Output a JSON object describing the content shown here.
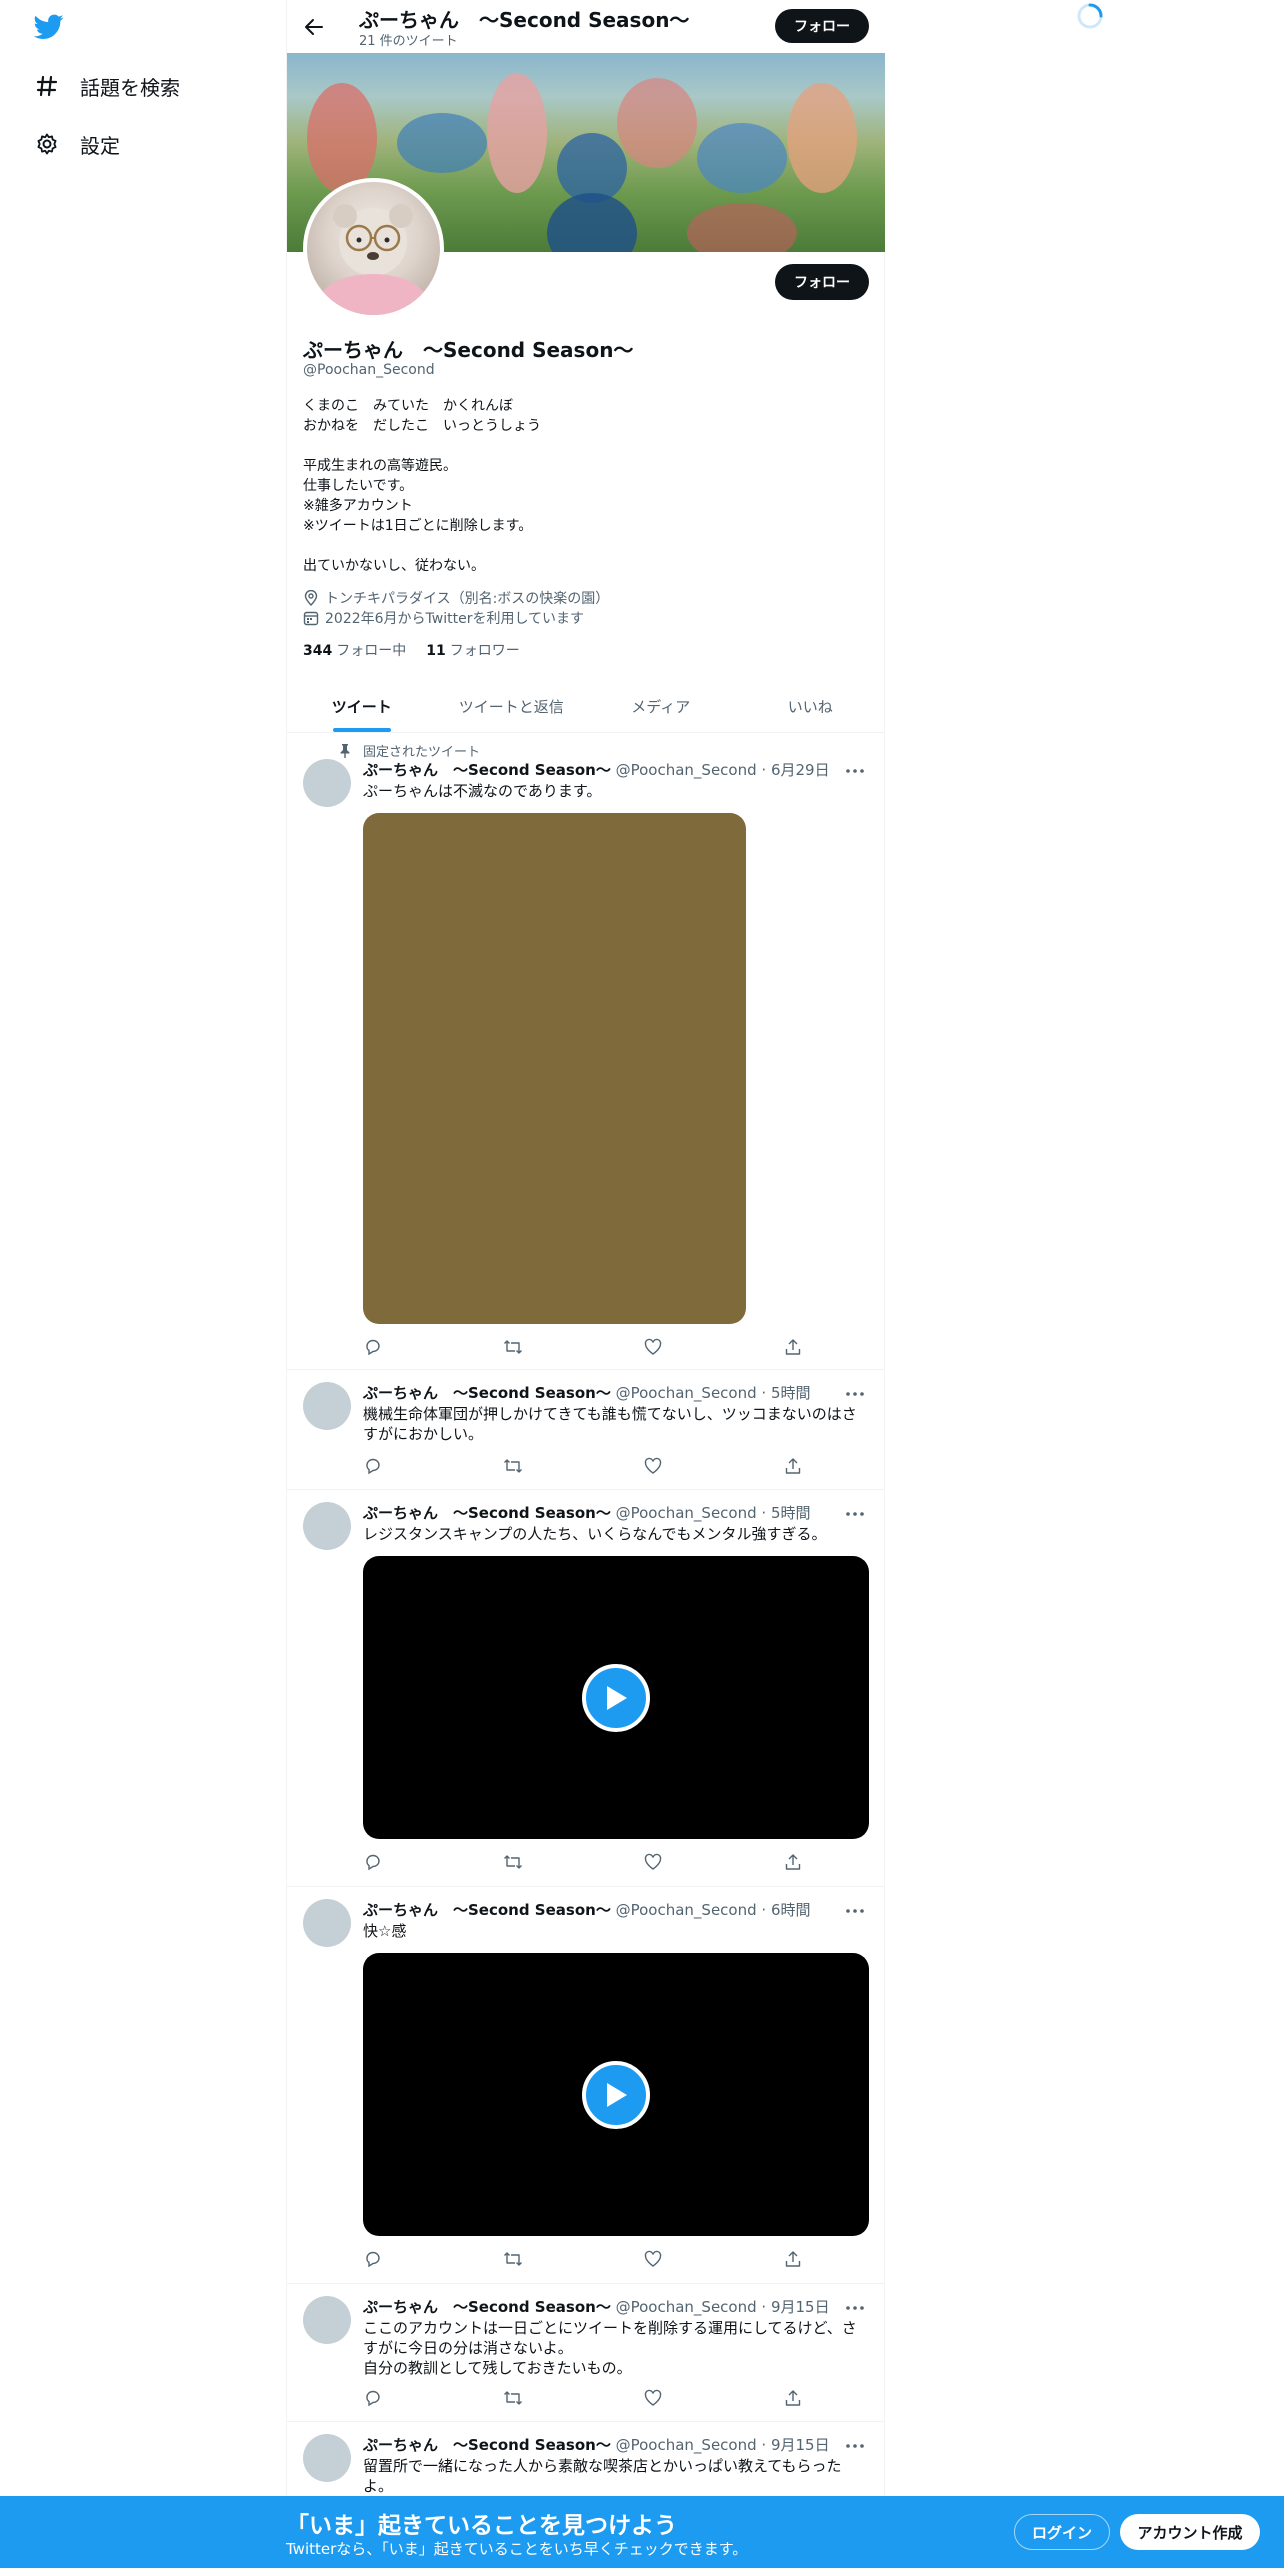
{
  "nav": {
    "items": [
      {
        "label": "話題を検索",
        "icon": "hashtag-icon"
      },
      {
        "label": "設定",
        "icon": "gear-icon"
      }
    ]
  },
  "header": {
    "name": "ぷーちゃん　～Second Season〜",
    "tweet_count": "21 件のツイート",
    "follow_label": "フォロー"
  },
  "profile": {
    "name": "ぷーちゃん　～Second Season〜",
    "handle": "@Poochan_Second",
    "bio": "くまのこ　みていた　かくれんぼ\nおかねを　だしたこ　いっとうしょう\n\n平成生まれの高等遊民。\n仕事したいです。\n※雑多アカウント\n※ツイートは1日ごとに削除します。\n\n出ていかないし、従わない。",
    "location": "トンチキパラダイス（別名:ボスの快楽の園）",
    "joined": "2022年6月からTwitterを利用しています",
    "following_count": "344",
    "following_label": "フォロー中",
    "followers_count": "11",
    "followers_label": "フォロワー",
    "follow_label": "フォロー"
  },
  "tabs": [
    "ツイート",
    "ツイートと返信",
    "メディア",
    "いいね"
  ],
  "pinned_label": "固定されたツイート",
  "tweets": [
    {
      "name": "ぷーちゃん　～Second Season〜",
      "handle": "@Poochan_Second",
      "time": "6月29日",
      "text": "ぷーちゃんは不滅なのであります。"
    },
    {
      "name": "ぷーちゃん　～Second Season〜",
      "handle": "@Poochan_Second",
      "time": "5時間",
      "text": "機械生命体軍団が押しかけてきても誰も慌てないし、ツッコまないのはさすがにおかしい。"
    },
    {
      "name": "ぷーちゃん　～Second Season〜",
      "handle": "@Poochan_Second",
      "time": "5時間",
      "text": "レジスタンスキャンプの人たち、いくらなんでもメンタル強すぎる。"
    },
    {
      "name": "ぷーちゃん　～Second Season〜",
      "handle": "@Poochan_Second",
      "time": "6時間",
      "text": "快☆感"
    },
    {
      "name": "ぷーちゃん　～Second Season〜",
      "handle": "@Poochan_Second",
      "time": "9月15日",
      "text": "ここのアカウントは一日ごとにツイートを削除する運用にしてるけど、さすがに今日の分は消さないよ。\n自分の教訓として残しておきたいもの。"
    },
    {
      "name": "ぷーちゃん　～Second Season〜",
      "handle": "@Poochan_Second",
      "time": "9月15日",
      "text": "留置所で一緒になった人から素敵な喫茶店とかいっぱい教えてもらったよ。"
    }
  ],
  "bottom_bar": {
    "title": "「いま」起きていることを見つけよう",
    "subtitle": "Twitterなら、「いま」起きていることをいち早くチェックできます。",
    "login_label": "ログイン",
    "signup_label": "アカウント作成"
  },
  "colors": {
    "accent": "#1d9bf0",
    "text": "#0f1419",
    "secondary": "#536471",
    "media_placeholder": "#7f6a3c"
  }
}
